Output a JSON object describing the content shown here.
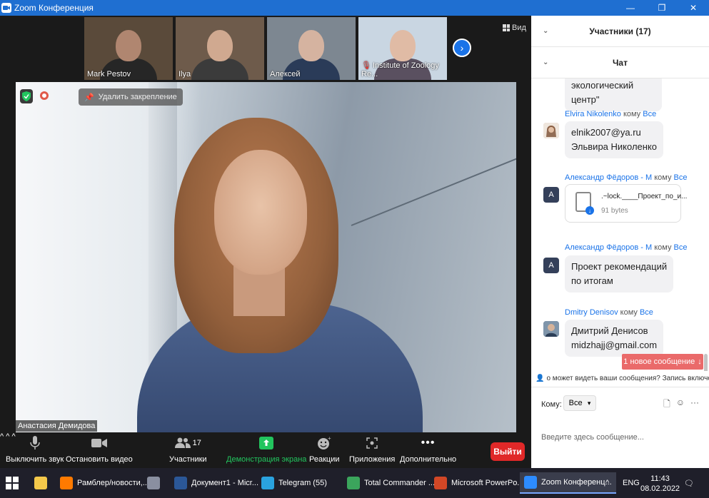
{
  "window": {
    "title": "Zoom Конференция",
    "minimize": "—",
    "maximize": "❐",
    "close": "✕"
  },
  "thumbnails": [
    {
      "name": "Mark Pestov",
      "muted": false,
      "bg": "#5a4a3a",
      "skin": "#b08670",
      "shirt": "#262626"
    },
    {
      "name": "Ilya",
      "muted": false,
      "bg": "#6e5b4b",
      "skin": "#d0a990",
      "shirt": "#3b3b3b"
    },
    {
      "name": "Алексей",
      "muted": false,
      "bg": "#7d8791",
      "skin": "#d5b3a0",
      "shirt": "#2a3b58"
    },
    {
      "name": "Institute of Zoology Re...",
      "muted": true,
      "bg": "#c9d6e2",
      "skin": "#e0bba5",
      "shirt": "#5a5060"
    }
  ],
  "view_label": "Вид",
  "unpin_label": "Удалить закрепление",
  "speaker_name": "Анастасия Демидова",
  "toolbar": {
    "mute": "Выключить звук",
    "video": "Остановить видео",
    "participants": "Участники",
    "participants_count": "17",
    "share": "Демонстрация экрана",
    "reactions": "Реакции",
    "apps": "Приложения",
    "more": "Дополнительно",
    "leave": "Выйти"
  },
  "sidebar": {
    "participants_header": "Участники (17)",
    "chat_header": "Чат",
    "partial_message": "экологический центр\"",
    "messages": [
      {
        "sender": "Elvira Nikolenko",
        "to_word": "кому",
        "recipient": "Все",
        "lines": [
          "elnik2007@ya.ru",
          "Эльвира Николенко"
        ]
      },
      {
        "sender": "Александр Фёдоров - М",
        "to_word": "кому",
        "recipient": "Все",
        "avatar": "A",
        "file_name": ".~lock.____Проект_по_и...",
        "file_size": "91 bytes"
      },
      {
        "sender": "Александр Фёдоров - М",
        "to_word": "кому",
        "recipient": "Все",
        "avatar": "A",
        "lines": [
          "Проект рекомендаций",
          "по итогам"
        ]
      },
      {
        "sender": "Dmitry Denisov",
        "to_word": "кому",
        "recipient": "Все",
        "lines": [
          "Дмитрий Денисов",
          "midzhajj@gmail.com"
        ]
      }
    ],
    "new_message": "1 новое сообщение",
    "who_sees": "о может видеть ваши сообщения? Запись включен",
    "to_label": "Кому:",
    "to_value": "Все",
    "input_placeholder": "Введите здесь сообщение..."
  },
  "taskbar": {
    "items": [
      {
        "label": "Рамблер/новости,...",
        "icon": "firefox-icon",
        "color": "#ff7a00"
      },
      {
        "label": "",
        "icon": "photo-icon",
        "color": "#8a8fa0"
      },
      {
        "label": "Документ1 - Micr...",
        "icon": "word-icon",
        "color": "#2b5797"
      },
      {
        "label": "Telegram (55)",
        "icon": "telegram-icon",
        "color": "#2aa3df"
      },
      {
        "label": "Total Commander ...",
        "icon": "totalcmd-icon",
        "color": "#3ba55c"
      },
      {
        "label": "Microsoft PowerPo...",
        "icon": "powerpoint-icon",
        "color": "#d24726"
      },
      {
        "label": "Zoom Конференц...",
        "icon": "zoom-icon",
        "color": "#2d8cff"
      }
    ],
    "lang": "ENG",
    "time": "11:43",
    "date": "08.02.2022"
  }
}
